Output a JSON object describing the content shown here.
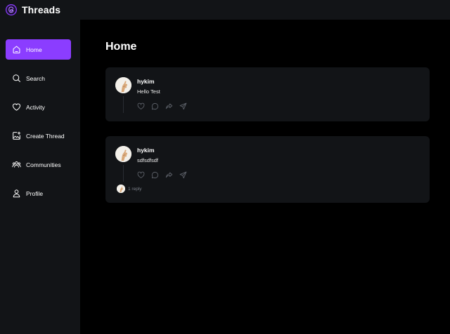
{
  "app": {
    "brand": "Threads",
    "accent": "#8b3dff"
  },
  "sidebar": {
    "items": [
      {
        "label": "Home",
        "icon": "home-icon",
        "active": true
      },
      {
        "label": "Search",
        "icon": "search-icon",
        "active": false
      },
      {
        "label": "Activity",
        "icon": "heart-icon",
        "active": false
      },
      {
        "label": "Create Thread",
        "icon": "create-thread-icon",
        "active": false
      },
      {
        "label": "Communities",
        "icon": "communities-icon",
        "active": false
      },
      {
        "label": "Profile",
        "icon": "profile-icon",
        "active": false
      }
    ]
  },
  "main": {
    "title": "Home",
    "threads": [
      {
        "author": "hykim",
        "text": "Hello Test",
        "replies": ""
      },
      {
        "author": "hykim",
        "text": "sdfsdfsdf",
        "replies": "1 reply"
      }
    ]
  }
}
